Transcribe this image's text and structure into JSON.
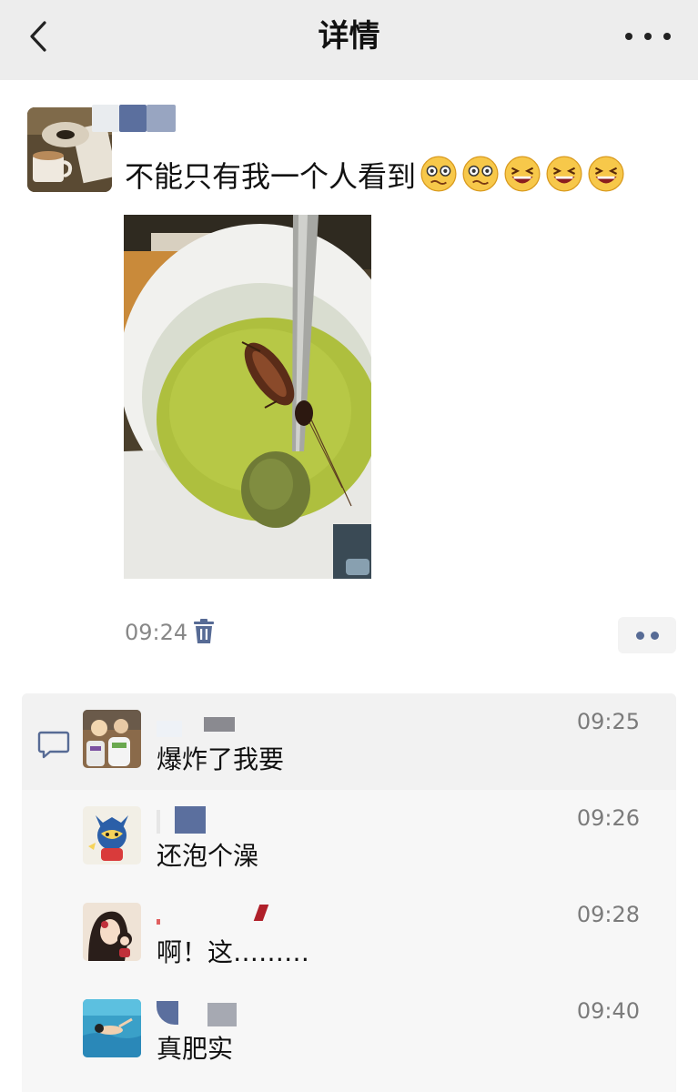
{
  "header": {
    "title": "详情",
    "back_icon": "chevron-left-icon",
    "more_icon": "more-horizontal-icon"
  },
  "post": {
    "text": "不能只有我一个人看到",
    "emojis": [
      "woozy-face",
      "woozy-face",
      "laughing-crying-face",
      "laughing-crying-face",
      "laughing-crying-face"
    ],
    "time": "09:24",
    "delete_icon": "trash-icon",
    "action_icon": "comment-like-dots-icon"
  },
  "comments": [
    {
      "text": "爆炸了我要",
      "time": "09:25"
    },
    {
      "text": "还泡个澡",
      "time": "09:26"
    },
    {
      "text": "啊！这………",
      "time": "09:28"
    },
    {
      "text": "真肥实",
      "time": "09:40"
    }
  ],
  "colors": {
    "nav_bg": "#ededed",
    "link_blue": "#576b95",
    "comment_bg": "#f7f7f7"
  }
}
